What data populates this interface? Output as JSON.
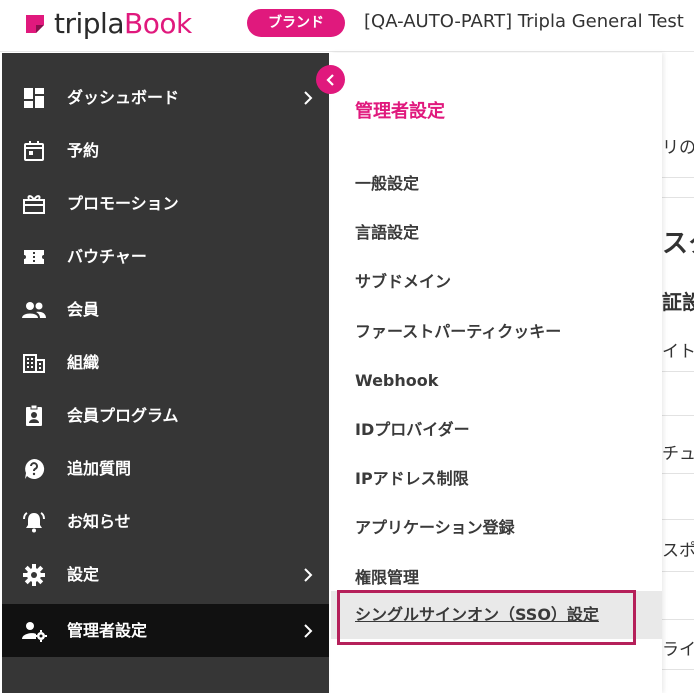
{
  "header": {
    "logo": {
      "prefix": "tripla",
      "suffix": "Book"
    },
    "brand_badge": "ブランド",
    "property_name": "[QA-AUTO-PART] Tripla General Test"
  },
  "colors": {
    "accent": "#e0197d",
    "sidebar_bg": "#363636",
    "sidebar_active_bg": "#111111",
    "highlight_border": "#b5205a"
  },
  "sidebar": {
    "items": [
      {
        "label": "ダッシュボード",
        "icon": "dashboard-icon",
        "has_children": true
      },
      {
        "label": "予約",
        "icon": "calendar-icon",
        "has_children": false
      },
      {
        "label": "プロモーション",
        "icon": "gift-icon",
        "has_children": false
      },
      {
        "label": "バウチャー",
        "icon": "ticket-icon",
        "has_children": false
      },
      {
        "label": "会員",
        "icon": "people-icon",
        "has_children": false
      },
      {
        "label": "組織",
        "icon": "building-icon",
        "has_children": false
      },
      {
        "label": "会員プログラム",
        "icon": "member-badge-icon",
        "has_children": false
      },
      {
        "label": "追加質問",
        "icon": "question-icon",
        "has_children": false
      },
      {
        "label": "お知らせ",
        "icon": "bell-icon",
        "has_children": false
      },
      {
        "label": "設定",
        "icon": "gear-icon",
        "has_children": true
      },
      {
        "label": "管理者設定",
        "icon": "admin-settings-icon",
        "has_children": true,
        "active": true
      }
    ]
  },
  "submenu": {
    "title": "管理者設定",
    "items": [
      {
        "label": "一般設定"
      },
      {
        "label": "言語設定"
      },
      {
        "label": "サブドメイン"
      },
      {
        "label": "ファーストパーティクッキー"
      },
      {
        "label": "Webhook"
      },
      {
        "label": "IDプロバイダー"
      },
      {
        "label": "IPアドレス制限"
      },
      {
        "label": "アプリケーション登録"
      },
      {
        "label": "権限管理"
      },
      {
        "label": "シングルサインオン（SSO）設定",
        "selected": true
      }
    ]
  },
  "main_fragments": [
    "リのｔ",
    "スタ",
    "証設",
    "イト",
    "チュ",
    "スポ",
    "ライ"
  ]
}
